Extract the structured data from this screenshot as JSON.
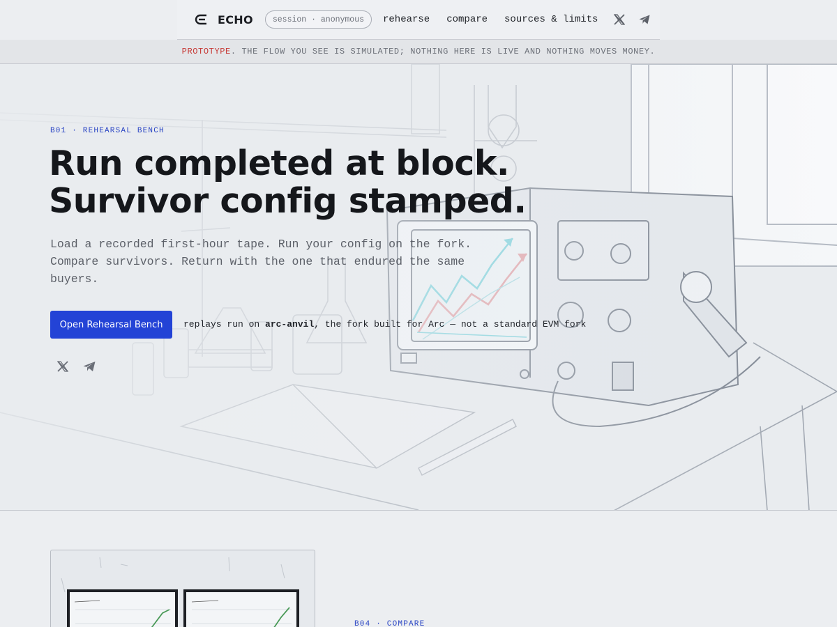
{
  "nav": {
    "brand": "ECHO",
    "session": "session · anonymous",
    "links": [
      "rehearse",
      "compare",
      "sources & limits"
    ],
    "icons": [
      "x-icon",
      "telegram-icon"
    ]
  },
  "banner": {
    "prefix": "PROTOTYPE",
    "text": ". THE FLOW YOU SEE IS SIMULATED; NOTHING HERE IS LIVE AND NOTHING MOVES MONEY."
  },
  "hero": {
    "eyebrow": "B01 · REHEARSAL BENCH",
    "headline_line1": "Run completed at block.",
    "headline_line2": "Survivor config stamped.",
    "subtext": "Load a recorded first-hour tape. Run your config on the fork. Compare survivors. Return with the one that endured the same buyers.",
    "cta_label": "Open Rehearsal Bench",
    "cta_note_pre": "replays run on ",
    "cta_note_bold": "arc-anvil",
    "cta_note_post": ", the fork built for Arc — not a standard EVM fork"
  },
  "section2": {
    "eyebrow": "B04 · COMPARE"
  },
  "colors": {
    "accent": "#2343d6",
    "warning": "#c73a36",
    "eyebrow": "#2a45c4"
  }
}
